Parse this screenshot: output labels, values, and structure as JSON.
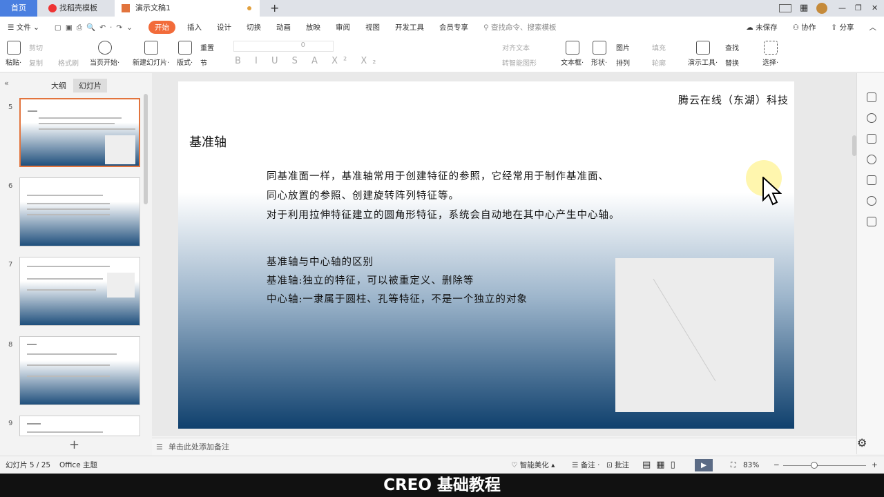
{
  "tabs": [
    {
      "label": "首页"
    },
    {
      "label": "找稻壳模板"
    },
    {
      "label": "演示文稿1"
    }
  ],
  "menu": {
    "file": "文件",
    "items": [
      "开始",
      "插入",
      "设计",
      "切换",
      "动画",
      "放映",
      "审阅",
      "视图",
      "开发工具",
      "会员专享"
    ],
    "search_placeholder": "查找命令、搜索模板",
    "unsaved": "未保存",
    "collab": "协作",
    "share": "分享"
  },
  "ribbon": {
    "paste": "粘贴",
    "cut": "剪切",
    "copy": "复制",
    "format_painter": "格式刷",
    "play_from_current": "当页开始",
    "new_slide": "新建幻灯片",
    "layout": "版式",
    "reset": "重置",
    "section": "节",
    "font_size": "0",
    "align_text": "对齐文本",
    "smartart": "转智能图形",
    "textbox": "文本框",
    "shape": "形状",
    "picture": "图片",
    "fill": "填充",
    "arrange": "排列",
    "outline": "轮廓",
    "tools": "演示工具",
    "find": "查找",
    "replace": "替换",
    "select": "选择"
  },
  "panel": {
    "outline_tab": "大纲",
    "slides_tab": "幻灯片",
    "slide_numbers": [
      "5",
      "6",
      "7",
      "8",
      "9"
    ],
    "add": "+"
  },
  "slide": {
    "company": "腾云在线（东湖）科技",
    "title": "基准轴",
    "para1": "同基准面一样，基准轴常用于创建特征的参照，它经常用于制作基准面、",
    "para2": "同心放置的参照、创建旋转阵列特征等。",
    "para3": "对于利用拉伸特征建立的圆角形特征，系统会自动地在其中心产生中心轴。",
    "sub_title": "基准轴与中心轴的区别",
    "line1": "基准轴:独立的特征，可以被重定义、删除等",
    "line2": "中心轴:一隶属于圆柱、孔等特征，不是一个独立的对象"
  },
  "notes": {
    "placeholder": "单击此处添加备注",
    "ime": "中"
  },
  "status": {
    "slide_count": "幻灯片 5 / 25",
    "theme": "Office 主题",
    "beautify": "智能美化",
    "notes": "备注",
    "comments": "批注",
    "zoom": "83%"
  },
  "caption": "CREO 基础教程",
  "colors": {
    "accent": "#f26b3a",
    "home_tab": "#4a7fe0",
    "slide_dark": "#0f406d"
  }
}
